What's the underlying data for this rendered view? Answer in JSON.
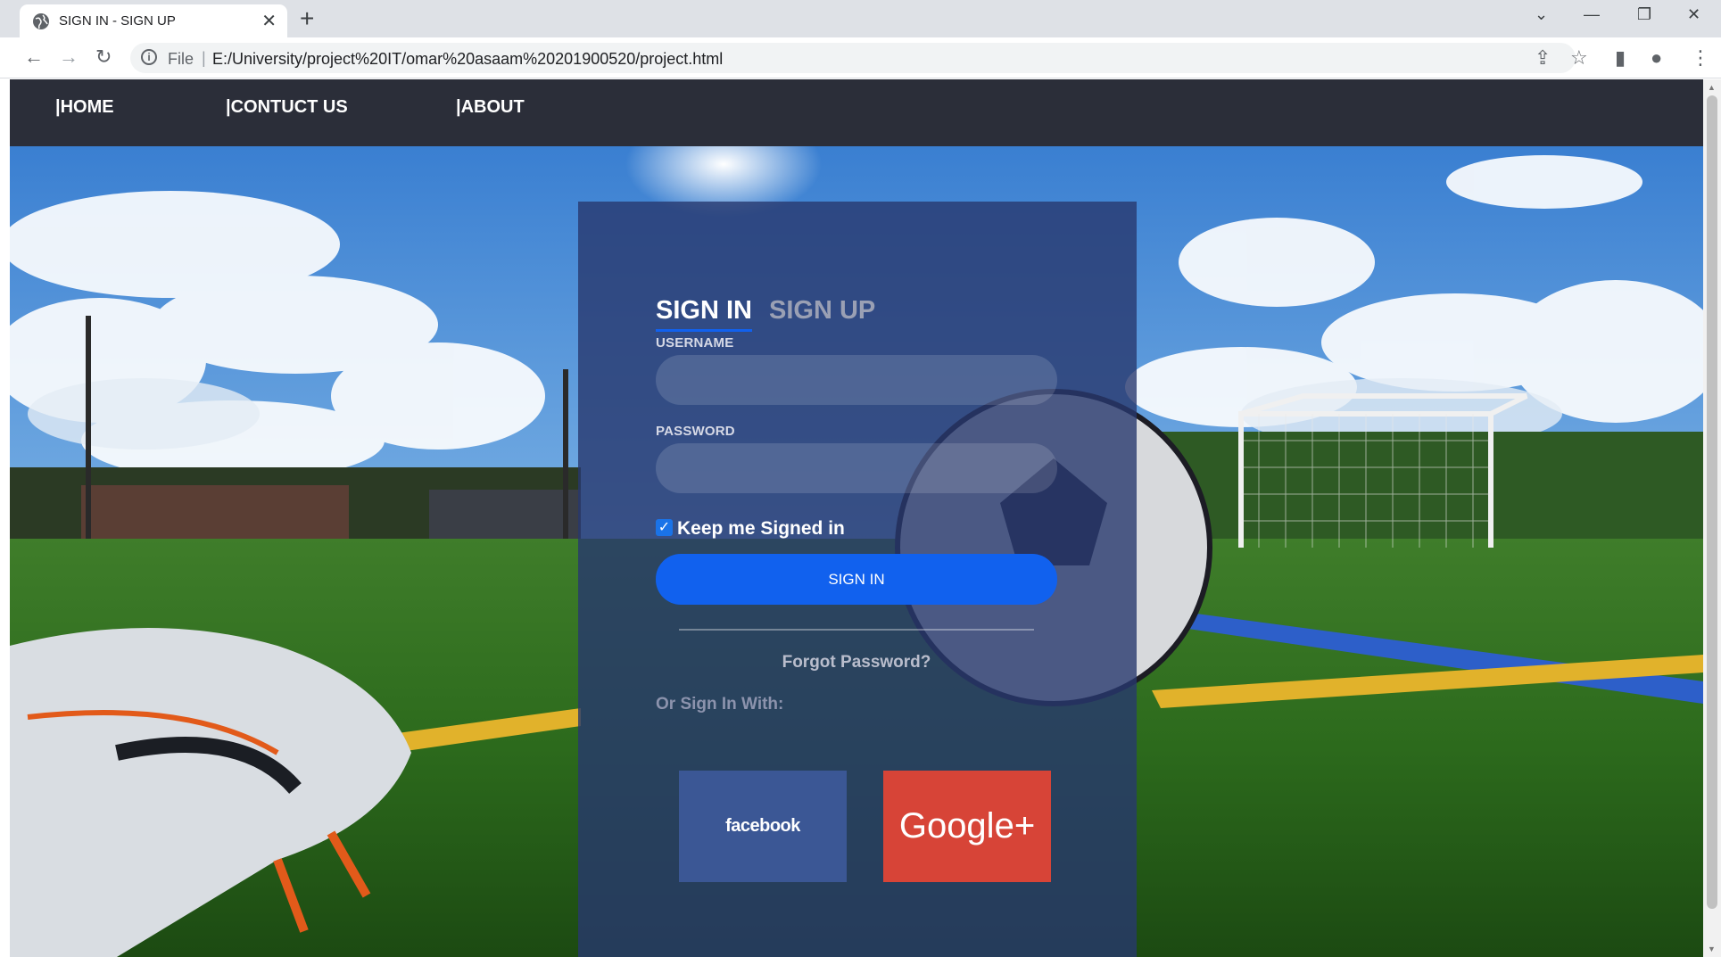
{
  "browser": {
    "tab_title": "SIGN IN - SIGN UP",
    "url_scheme": "File",
    "url": "E:/University/project%20IT/omar%20asaam%20201900520/project.html"
  },
  "site_nav": {
    "items": [
      {
        "label": "|HOME"
      },
      {
        "label": "|CONTUCT US"
      },
      {
        "label": "|ABOUT"
      }
    ]
  },
  "login": {
    "tab_signin": "SIGN IN",
    "tab_signup": "SIGN UP",
    "username_label": "USERNAME",
    "username_value": "",
    "password_label": "PASSWORD",
    "password_value": "",
    "keep_signed_in_label": "Keep me Signed in",
    "keep_signed_in_checked": true,
    "signin_button": "SIGN IN",
    "forgot_password": "Forgot Password?",
    "or_sign_in_with": "Or Sign In With:",
    "facebook_label": "facebook",
    "google_label": "Google+"
  },
  "colors": {
    "nav_bg": "#2b2e39",
    "panel_bg": "rgba(40,56,110,0.80)",
    "accent": "#1161ee",
    "facebook": "#3b5795",
    "google": "#d74437"
  },
  "icons": [
    "globe-icon",
    "close-icon",
    "plus-icon",
    "back-icon",
    "forward-icon",
    "reload-icon",
    "info-icon",
    "share-icon",
    "star-icon",
    "sidepanel-icon",
    "profile-icon",
    "menu-icon",
    "checkmark-icon"
  ]
}
